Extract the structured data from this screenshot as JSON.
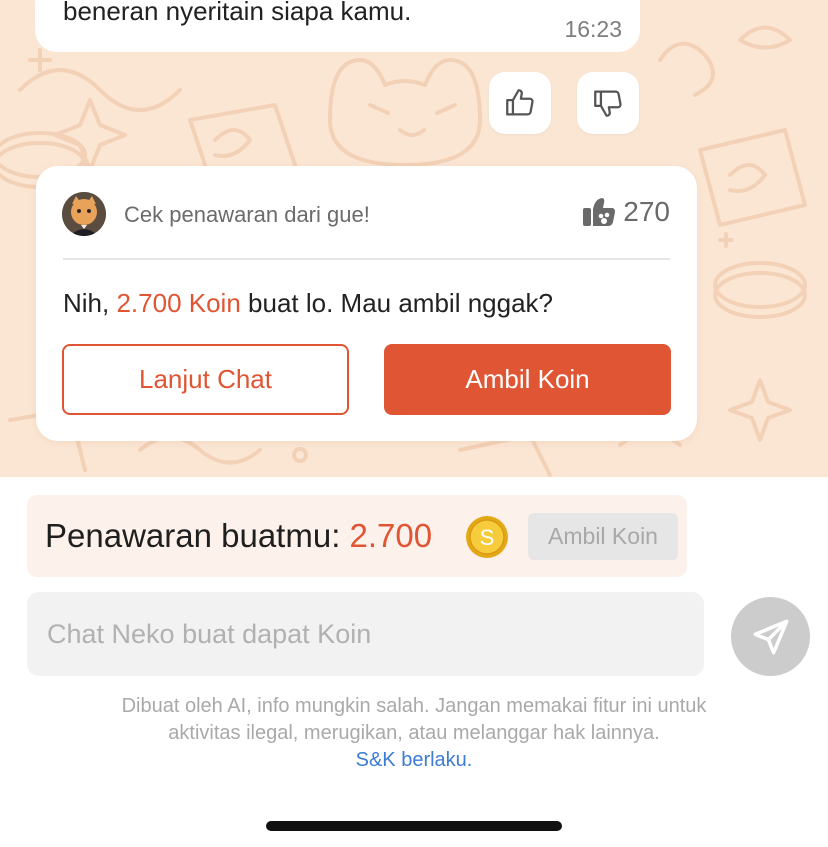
{
  "chat": {
    "previous_message": {
      "text": "beneran nyeritain siapa kamu.",
      "time": "16:23"
    },
    "reactions": [
      {
        "icon": "thumbs-up-icon"
      },
      {
        "icon": "thumbs-down-icon"
      }
    ]
  },
  "offer_card": {
    "header": "Cek penawaran dari gue!",
    "likes_icon": "paw-thumbs-up-icon",
    "likes_count": "270",
    "message_prefix": "Nih, ",
    "message_amount": "2.700 Koin",
    "message_suffix": " buat lo. Mau ambil nggak?",
    "continue_label": "Lanjut Chat",
    "take_label": "Ambil Koin"
  },
  "offer_bar": {
    "label": "Penawaran buatmu: ",
    "amount": "2.700",
    "coin_icon": "coin-icon",
    "button_label": "Ambil Koin"
  },
  "composer": {
    "placeholder": "Chat Neko buat dapat Koin",
    "send_icon": "send-icon"
  },
  "disclaimer": {
    "line1": "Dibuat oleh AI, info mungkin salah. Jangan memakai fitur ini untuk",
    "line2": "aktivitas ilegal, merugikan, atau melanggar hak lainnya.",
    "link": "S&K berlaku."
  },
  "colors": {
    "accent": "#e05533",
    "chat_background": "#fbe6d4",
    "link": "#3d7bd4"
  }
}
